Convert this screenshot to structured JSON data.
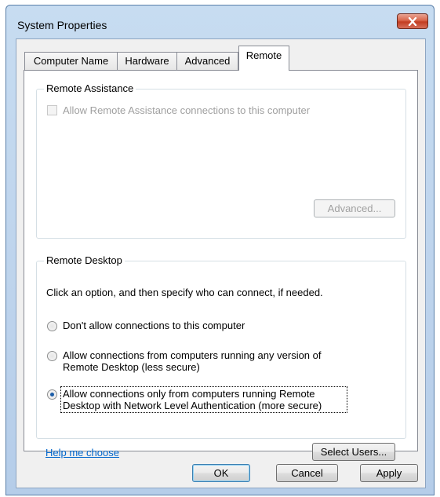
{
  "window": {
    "title": "System Properties"
  },
  "tabs": [
    {
      "label": "Computer Name"
    },
    {
      "label": "Hardware"
    },
    {
      "label": "Advanced"
    },
    {
      "label": "Remote"
    }
  ],
  "remote_assistance": {
    "group_title": "Remote Assistance",
    "allow_checkbox_label": "Allow Remote Assistance connections to this computer",
    "allow_checked": false,
    "advanced_button": "Advanced..."
  },
  "remote_desktop": {
    "group_title": "Remote Desktop",
    "instruction": "Click an option, and then specify who can connect, if needed.",
    "options": [
      {
        "label_line1": "Don't allow connections to this computer",
        "label_line2": "",
        "checked": false
      },
      {
        "label_line1": "Allow connections from computers running any version of",
        "label_line2": "Remote Desktop (less secure)",
        "checked": false
      },
      {
        "label_line1": "Allow connections only from computers running Remote",
        "label_line2": "Desktop with Network Level Authentication (more secure)",
        "checked": true
      }
    ],
    "help_link": "Help me choose",
    "select_users_button": "Select Users..."
  },
  "footer": {
    "ok_button": "OK",
    "cancel_button": "Cancel",
    "apply_button": "Apply"
  },
  "colors": {
    "titlebar": "#c7dcf1",
    "close_button": "#c23d22",
    "link": "#0066cc",
    "radio_dot": "#1d5ea8"
  }
}
